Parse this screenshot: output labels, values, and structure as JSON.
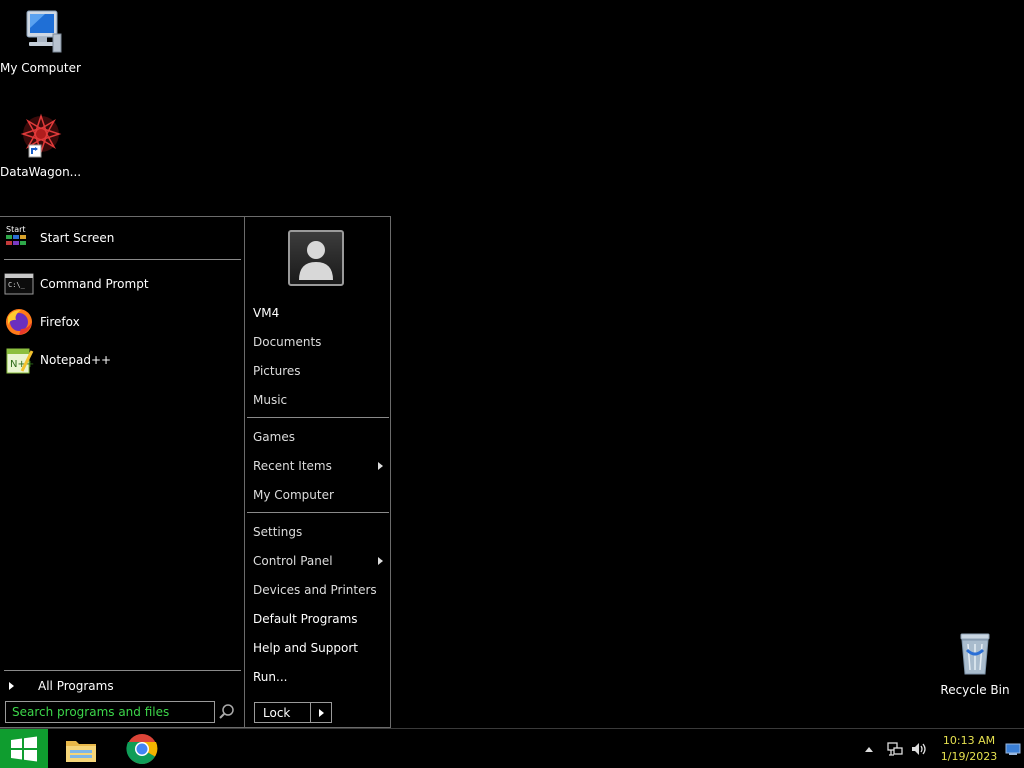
{
  "desktop": {
    "icons": [
      {
        "label": "My Computer",
        "icon": "computer-icon"
      },
      {
        "label": "DataWagon...",
        "icon": "datawagon-icon"
      },
      {
        "label": "Recycle Bin",
        "icon": "recycle-bin-icon"
      }
    ]
  },
  "start_menu": {
    "pinned": [
      {
        "label": "Start Screen",
        "icon": "start-screen-icon"
      },
      {
        "label": "Command Prompt",
        "icon": "command-prompt-icon"
      },
      {
        "label": "Firefox",
        "icon": "firefox-icon"
      },
      {
        "label": "Notepad++",
        "icon": "notepadpp-icon"
      }
    ],
    "all_programs": "All Programs",
    "search_placeholder": "Search programs and files",
    "user": "VM4",
    "right_items": [
      {
        "label": "Documents"
      },
      {
        "label": "Pictures"
      },
      {
        "label": "Music"
      },
      {
        "label": "Games"
      },
      {
        "label": "Recent Items",
        "submenu": true
      },
      {
        "label": "My Computer"
      },
      {
        "label": "Settings"
      },
      {
        "label": "Control Panel",
        "submenu": true
      },
      {
        "label": "Devices and Printers"
      },
      {
        "label": "Default Programs"
      },
      {
        "label": "Help and Support"
      },
      {
        "label": "Run..."
      }
    ],
    "lock_label": "Lock"
  },
  "taskbar": {
    "pinned": [
      "file-explorer-icon",
      "chrome-icon"
    ],
    "tray_icons": [
      "show-hidden-icons-icon",
      "network-icon",
      "volume-icon"
    ],
    "time": "10:13 AM",
    "date": "1/19/2023",
    "accent": "#0f9d2f",
    "clock_color": "#e5e04f"
  }
}
